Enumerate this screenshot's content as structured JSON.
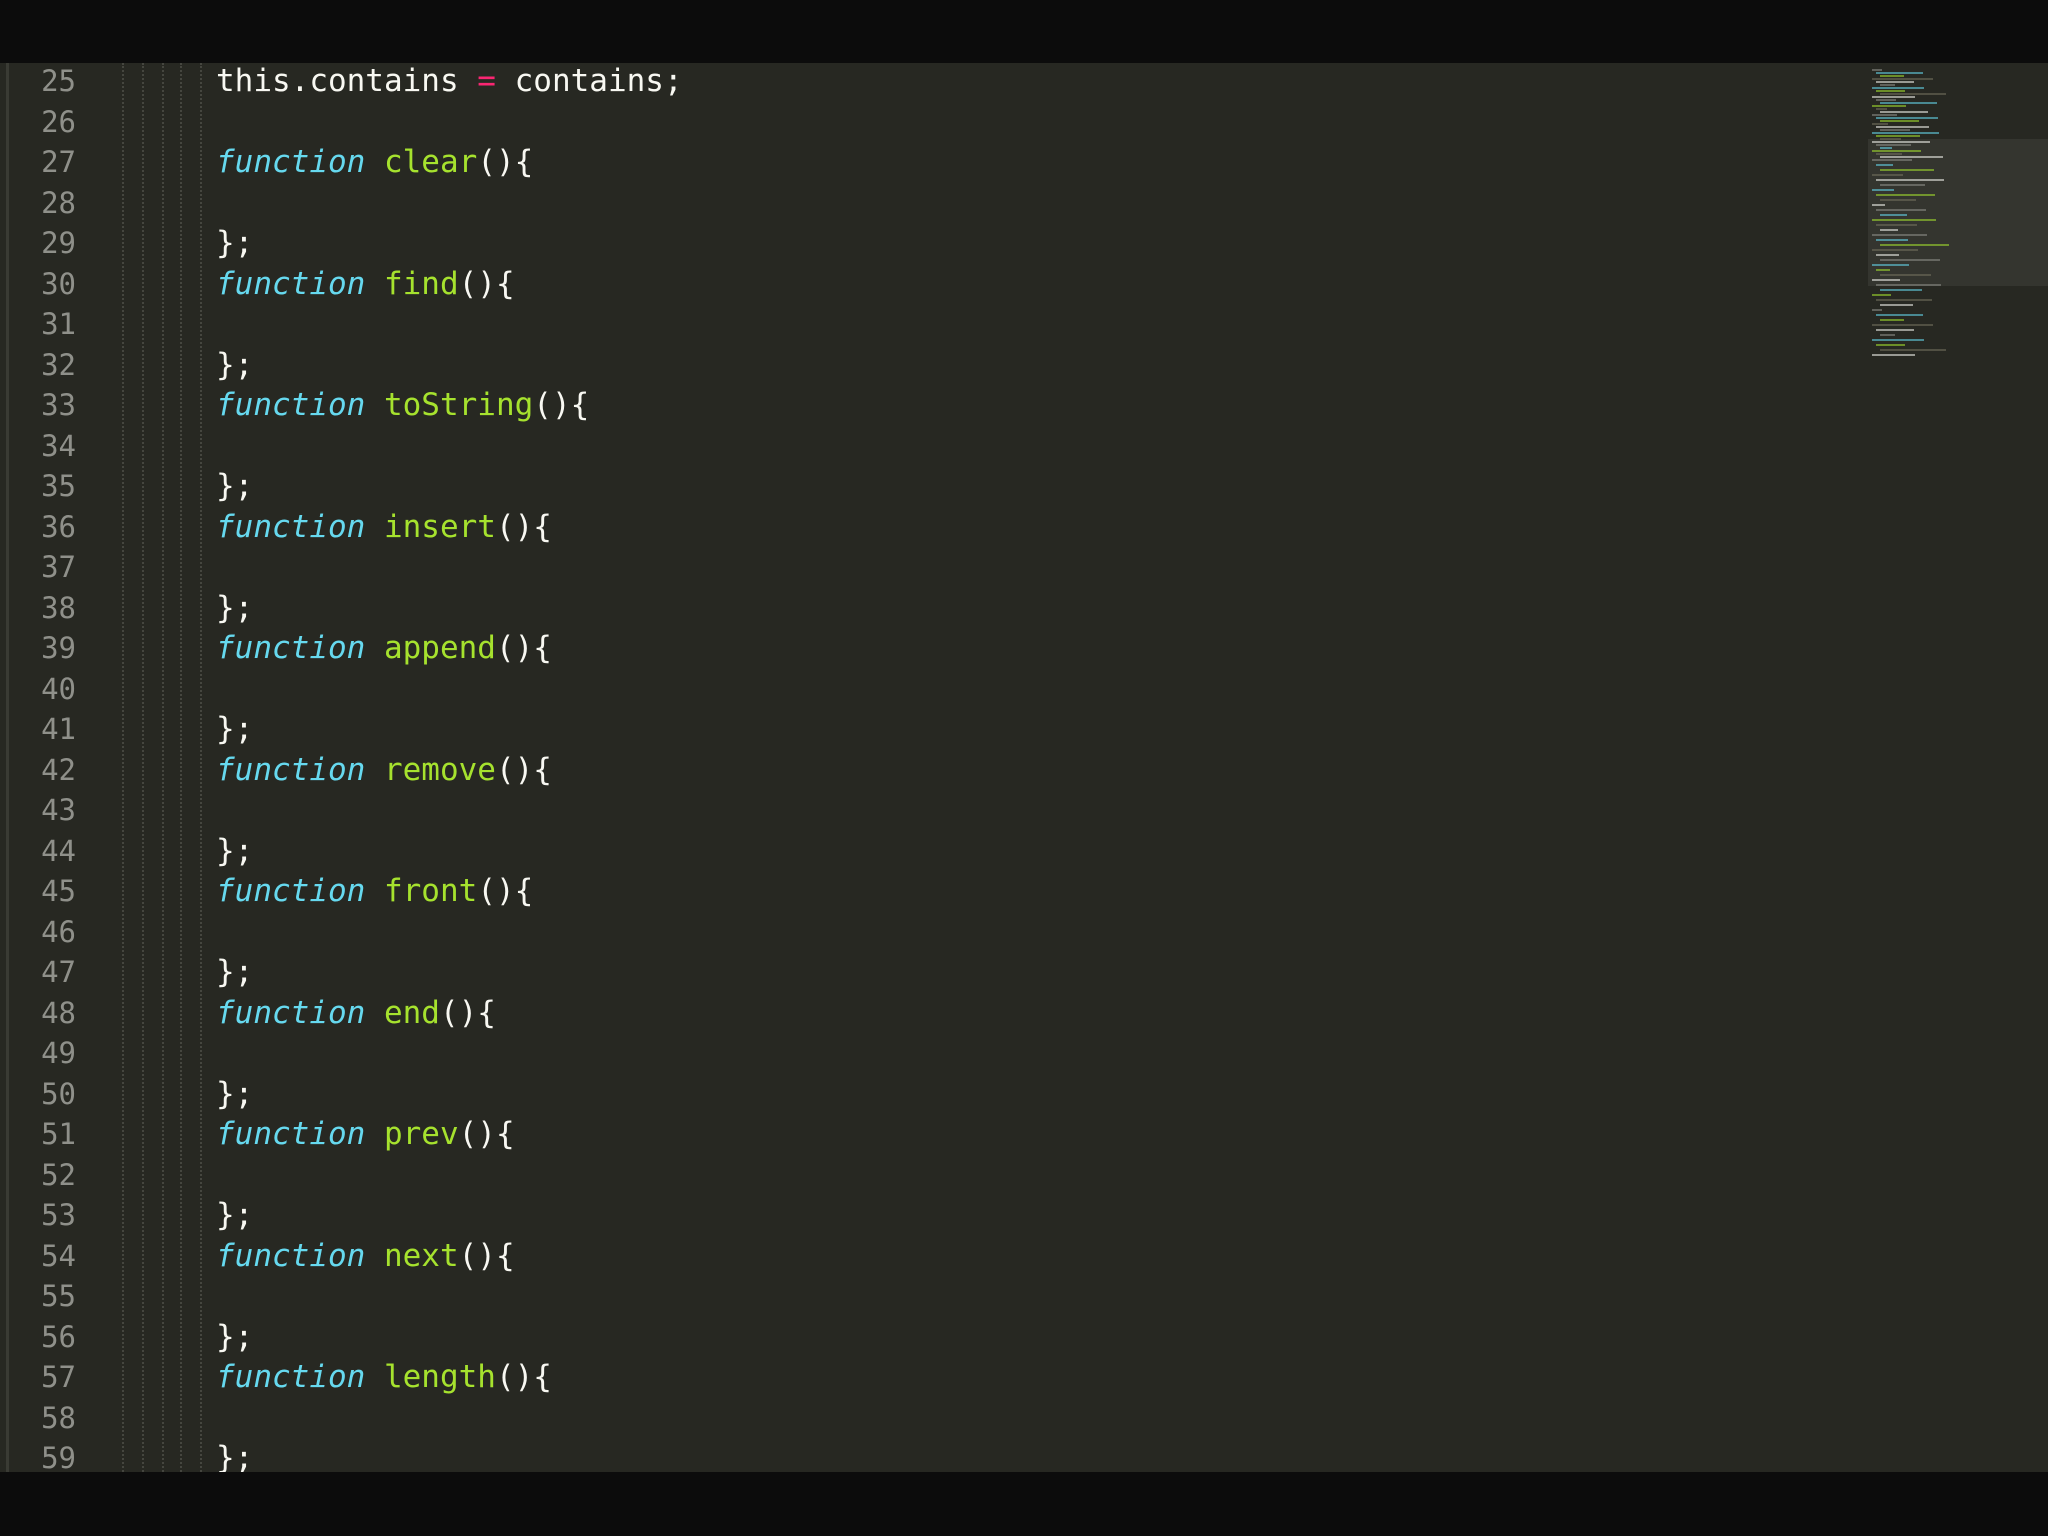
{
  "colors": {
    "background": "#272822",
    "line_number": "#8f908a",
    "keyword": "#66d9ef",
    "function_name": "#a6e22e",
    "operator": "#f92672",
    "text": "#f8f8f2"
  },
  "lines": [
    {
      "number": "25",
      "tokens": [
        {
          "t": "this.contains ",
          "c": "pl"
        },
        {
          "t": "=",
          "c": "op"
        },
        {
          "t": " contains;",
          "c": "pl"
        }
      ]
    },
    {
      "number": "26",
      "tokens": []
    },
    {
      "number": "27",
      "tokens": [
        {
          "t": "function",
          "c": "kw"
        },
        {
          "t": " ",
          "c": "pl"
        },
        {
          "t": "clear",
          "c": "fn"
        },
        {
          "t": "(){",
          "c": "pl"
        }
      ]
    },
    {
      "number": "28",
      "tokens": []
    },
    {
      "number": "29",
      "tokens": [
        {
          "t": "};",
          "c": "pl"
        }
      ]
    },
    {
      "number": "30",
      "tokens": [
        {
          "t": "function",
          "c": "kw"
        },
        {
          "t": " ",
          "c": "pl"
        },
        {
          "t": "find",
          "c": "fn"
        },
        {
          "t": "(){",
          "c": "pl"
        }
      ]
    },
    {
      "number": "31",
      "tokens": []
    },
    {
      "number": "32",
      "tokens": [
        {
          "t": "};",
          "c": "pl"
        }
      ]
    },
    {
      "number": "33",
      "tokens": [
        {
          "t": "function",
          "c": "kw"
        },
        {
          "t": " ",
          "c": "pl"
        },
        {
          "t": "toString",
          "c": "fn"
        },
        {
          "t": "(){",
          "c": "pl"
        }
      ]
    },
    {
      "number": "34",
      "tokens": []
    },
    {
      "number": "35",
      "tokens": [
        {
          "t": "};",
          "c": "pl"
        }
      ]
    },
    {
      "number": "36",
      "tokens": [
        {
          "t": "function",
          "c": "kw"
        },
        {
          "t": " ",
          "c": "pl"
        },
        {
          "t": "insert",
          "c": "fn"
        },
        {
          "t": "(){",
          "c": "pl"
        }
      ]
    },
    {
      "number": "37",
      "tokens": []
    },
    {
      "number": "38",
      "tokens": [
        {
          "t": "};",
          "c": "pl"
        }
      ]
    },
    {
      "number": "39",
      "tokens": [
        {
          "t": "function",
          "c": "kw"
        },
        {
          "t": " ",
          "c": "pl"
        },
        {
          "t": "append",
          "c": "fn"
        },
        {
          "t": "(){",
          "c": "pl"
        }
      ]
    },
    {
      "number": "40",
      "tokens": []
    },
    {
      "number": "41",
      "tokens": [
        {
          "t": "};",
          "c": "pl"
        }
      ]
    },
    {
      "number": "42",
      "tokens": [
        {
          "t": "function",
          "c": "kw"
        },
        {
          "t": " ",
          "c": "pl"
        },
        {
          "t": "remove",
          "c": "fn"
        },
        {
          "t": "(){",
          "c": "pl"
        }
      ]
    },
    {
      "number": "43",
      "tokens": []
    },
    {
      "number": "44",
      "tokens": [
        {
          "t": "};",
          "c": "pl"
        }
      ]
    },
    {
      "number": "45",
      "tokens": [
        {
          "t": "function",
          "c": "kw"
        },
        {
          "t": " ",
          "c": "pl"
        },
        {
          "t": "front",
          "c": "fn"
        },
        {
          "t": "(){",
          "c": "pl"
        }
      ]
    },
    {
      "number": "46",
      "tokens": []
    },
    {
      "number": "47",
      "tokens": [
        {
          "t": "};",
          "c": "pl"
        }
      ]
    },
    {
      "number": "48",
      "tokens": [
        {
          "t": "function",
          "c": "kw"
        },
        {
          "t": " ",
          "c": "pl"
        },
        {
          "t": "end",
          "c": "fn"
        },
        {
          "t": "(){",
          "c": "pl"
        }
      ]
    },
    {
      "number": "49",
      "tokens": []
    },
    {
      "number": "50",
      "tokens": [
        {
          "t": "};",
          "c": "pl"
        }
      ]
    },
    {
      "number": "51",
      "tokens": [
        {
          "t": "function",
          "c": "kw"
        },
        {
          "t": " ",
          "c": "pl"
        },
        {
          "t": "prev",
          "c": "fn"
        },
        {
          "t": "(){",
          "c": "pl"
        }
      ]
    },
    {
      "number": "52",
      "tokens": []
    },
    {
      "number": "53",
      "tokens": [
        {
          "t": "};",
          "c": "pl"
        }
      ]
    },
    {
      "number": "54",
      "tokens": [
        {
          "t": "function",
          "c": "kw"
        },
        {
          "t": " ",
          "c": "pl"
        },
        {
          "t": "next",
          "c": "fn"
        },
        {
          "t": "(){",
          "c": "pl"
        }
      ]
    },
    {
      "number": "55",
      "tokens": []
    },
    {
      "number": "56",
      "tokens": [
        {
          "t": "};",
          "c": "pl"
        }
      ]
    },
    {
      "number": "57",
      "tokens": [
        {
          "t": "function",
          "c": "kw"
        },
        {
          "t": " ",
          "c": "pl"
        },
        {
          "t": "length",
          "c": "fn"
        },
        {
          "t": "(){",
          "c": "pl"
        }
      ]
    },
    {
      "number": "58",
      "tokens": []
    },
    {
      "number": "59",
      "tokens": [
        {
          "t": "};",
          "c": "pl"
        }
      ]
    }
  ]
}
